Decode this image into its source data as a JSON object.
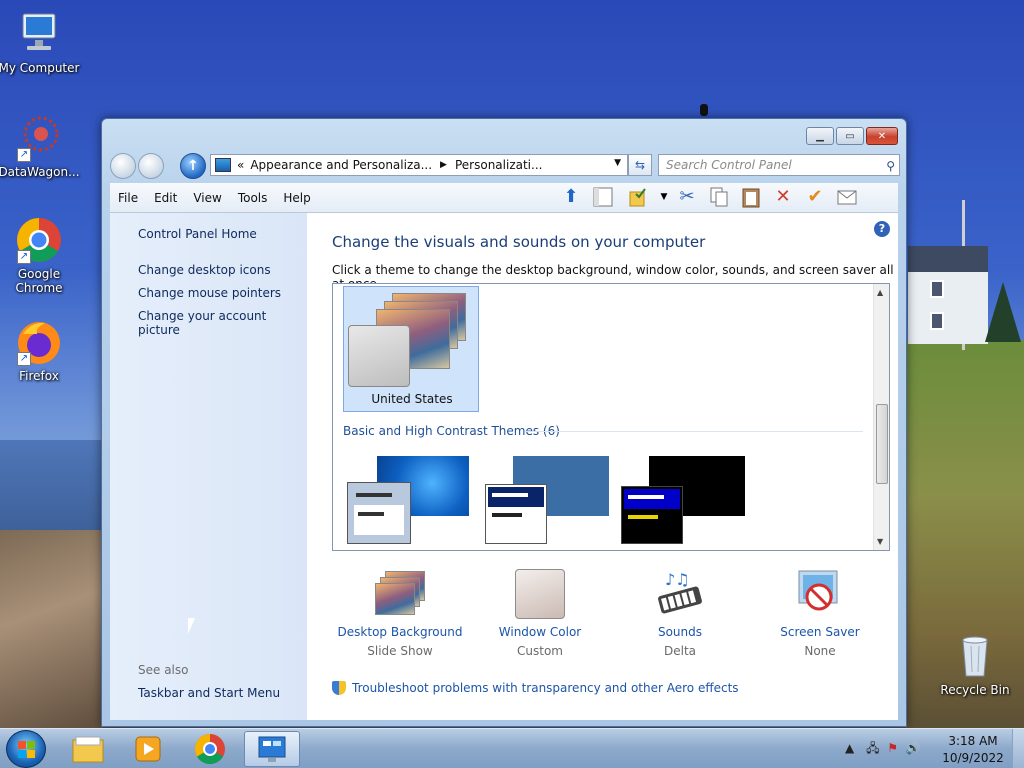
{
  "desktop": {
    "icons": [
      {
        "label": "My Computer"
      },
      {
        "label": "DataWagon..."
      },
      {
        "label": "Google Chrome"
      },
      {
        "label": "Firefox"
      },
      {
        "label": "Recycle Bin"
      }
    ]
  },
  "window": {
    "address": {
      "prefix": "«",
      "crumb1": "Appearance and Personaliza...",
      "crumb2": "Personalizati..."
    },
    "search_placeholder": "Search Control Panel",
    "menu": [
      "File",
      "Edit",
      "View",
      "Tools",
      "Help"
    ],
    "left_pane": {
      "home": "Control Panel Home",
      "links": [
        "Change desktop icons",
        "Change mouse pointers",
        "Change your account picture"
      ],
      "see_also": "See also",
      "see_also_links": [
        "Taskbar and Start Menu"
      ]
    },
    "heading": "Change the visuals and sounds on your computer",
    "subheading": "Click a theme to change the desktop background, window color, sounds, and screen saver all at once.",
    "selected_theme": "United States",
    "group_label": "Basic and High Contrast Themes (6)",
    "bottom_items": [
      {
        "title": "Desktop Background",
        "value": "Slide Show",
        "icon": "desktop-background-icon"
      },
      {
        "title": "Window Color",
        "value": "Custom",
        "icon": "window-color-icon"
      },
      {
        "title": "Sounds",
        "value": "Delta",
        "icon": "sounds-icon"
      },
      {
        "title": "Screen Saver",
        "value": "None",
        "icon": "screen-saver-icon"
      }
    ],
    "troubleshoot": "Troubleshoot problems with transparency and other Aero effects"
  },
  "taskbar": {
    "time": "3:18 AM",
    "date": "10/9/2022"
  }
}
